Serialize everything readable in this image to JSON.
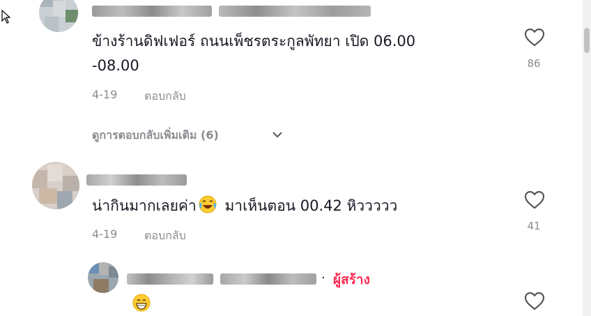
{
  "comments": [
    {
      "text_line1": "ข้างร้านดิฟเฟอร์ ถนนเพ็ชรตระกูลพัทยา เปิด 06.00",
      "text_line2": "-08.00",
      "date": "4-19",
      "reply_label": "ตอบกลับ",
      "likes": "86",
      "view_more": "ดูการตอบกลับเพิ่มเติม (6)"
    },
    {
      "text_before": "น่ากินมากเลยค่า",
      "text_after": " มาเห็นตอน 00.42 หิววววว",
      "date": "4-19",
      "reply_label": "ตอบกลับ",
      "likes": "41"
    },
    {
      "separator": "·",
      "creator_badge": "ผู้สร้าง"
    }
  ],
  "colors": {
    "accent": "#fe2c55",
    "muted": "#8a8b91",
    "text": "#161823"
  },
  "icons": [
    "heart-icon",
    "chevron-down-icon",
    "laughing-emoji-icon",
    "grinning-emoji-icon",
    "cursor-icon"
  ]
}
